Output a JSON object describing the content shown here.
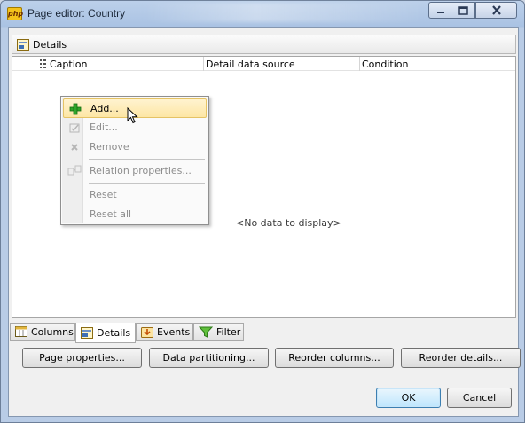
{
  "window": {
    "title": "Page editor: Country",
    "app_icon_text": "php",
    "controls": {
      "minimize": "minimize-icon",
      "maximize": "maximize-icon",
      "close": "close-icon"
    }
  },
  "details_group": {
    "label": "Details",
    "icon": "details-icon"
  },
  "grid": {
    "columns": [
      "Caption",
      "Detail data source",
      "Condition"
    ],
    "empty_text": "<No data to display>"
  },
  "context_menu": {
    "items": [
      {
        "label": "Add...",
        "icon": "add-icon",
        "enabled": true,
        "highlighted": true
      },
      {
        "label": "Edit...",
        "icon": "edit-icon",
        "enabled": false
      },
      {
        "label": "Remove",
        "icon": "remove-icon",
        "enabled": false
      },
      {
        "label": "Relation properties...",
        "icon": "relation-icon",
        "enabled": false
      },
      {
        "label": "Reset",
        "icon": "",
        "enabled": false
      },
      {
        "label": "Reset all",
        "icon": "",
        "enabled": false
      }
    ]
  },
  "tabs": [
    {
      "label": "Columns",
      "icon": "columns-icon",
      "active": false
    },
    {
      "label": "Details",
      "icon": "details-icon",
      "active": true
    },
    {
      "label": "Events",
      "icon": "events-icon",
      "active": false
    },
    {
      "label": "Filter",
      "icon": "filter-icon",
      "active": false
    }
  ],
  "action_buttons": {
    "page_properties": "Page properties...",
    "data_partitioning": "Data partitioning...",
    "reorder_columns": "Reorder columns...",
    "reorder_details": "Reorder details..."
  },
  "dialog_buttons": {
    "ok": "OK",
    "cancel": "Cancel"
  },
  "colors": {
    "accent": "#3c7fb1",
    "highlight": "#fde6a5",
    "disabled_text": "#8d8d8d"
  }
}
